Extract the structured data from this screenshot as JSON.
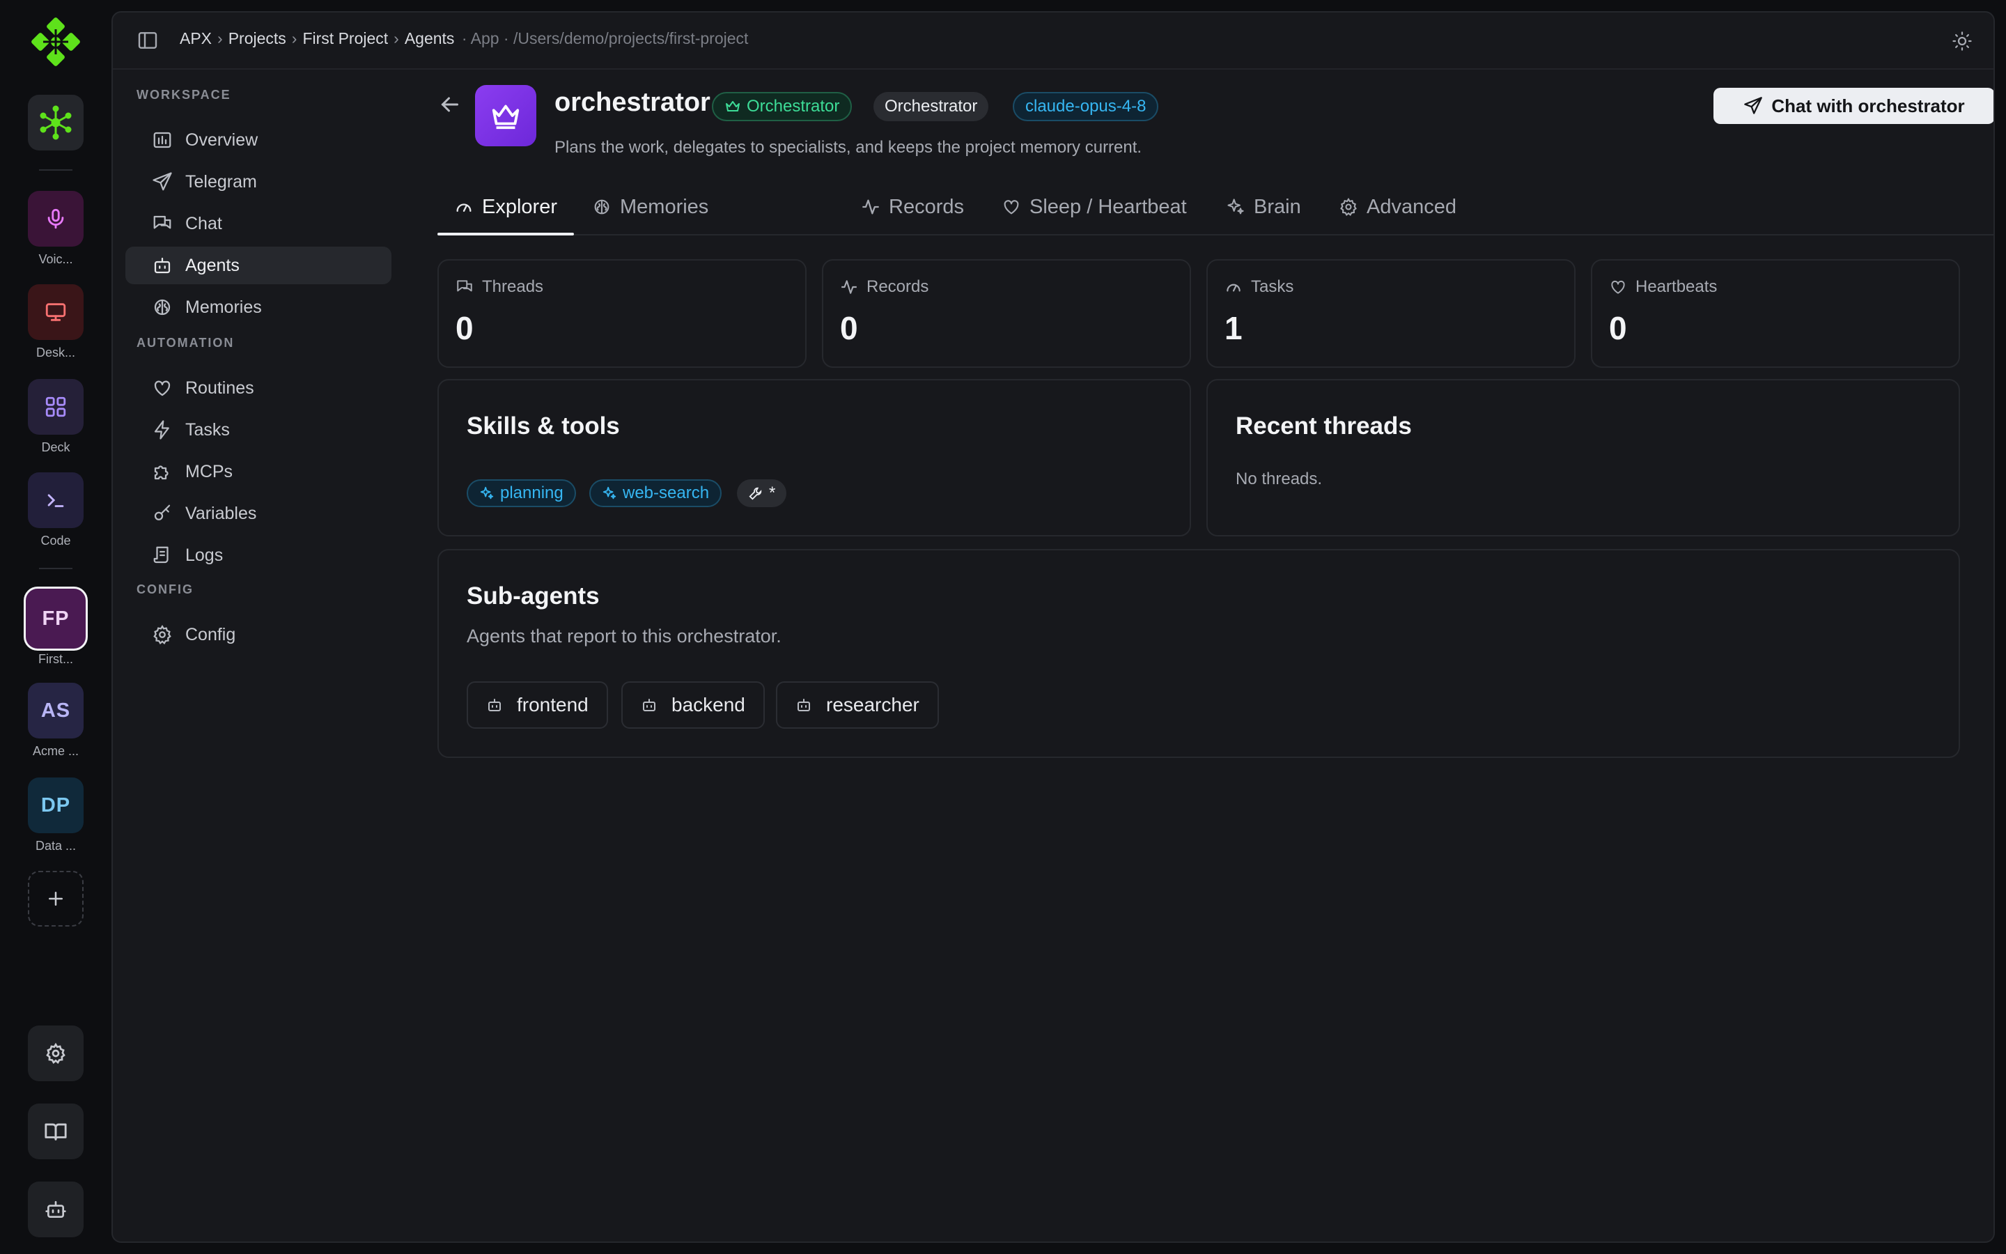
{
  "rail": {
    "items": [
      {
        "label": "Voic...",
        "icon": "mic-icon",
        "color": "#e879f9"
      },
      {
        "label": "Desk...",
        "icon": "monitor-icon",
        "color": "#f87171"
      },
      {
        "label": "Deck",
        "icon": "grid-icon",
        "color": "#a78bfa"
      },
      {
        "label": "Code",
        "icon": "terminal-icon",
        "color": "#c4b5fd"
      }
    ],
    "projects": [
      {
        "initials": "FP",
        "label": "First...",
        "active": true
      },
      {
        "initials": "AS",
        "label": "Acme ..."
      },
      {
        "initials": "DP",
        "label": "Data ..."
      }
    ]
  },
  "breadcrumb": {
    "items": [
      "APX",
      "Projects",
      "First Project",
      "Agents"
    ],
    "tail": "App · /Users/demo/projects/first-project"
  },
  "nav": {
    "workspace_label": "WORKSPACE",
    "workspace": [
      {
        "label": "Overview",
        "icon": "chart-icon"
      },
      {
        "label": "Telegram",
        "icon": "send-icon"
      },
      {
        "label": "Chat",
        "icon": "chat-icon"
      },
      {
        "label": "Agents",
        "icon": "bot-icon",
        "active": true
      },
      {
        "label": "Memories",
        "icon": "brain-icon"
      }
    ],
    "automation_label": "AUTOMATION",
    "automation": [
      {
        "label": "Routines",
        "icon": "heart-icon"
      },
      {
        "label": "Tasks",
        "icon": "bolt-icon"
      },
      {
        "label": "MCPs",
        "icon": "puzzle-icon"
      },
      {
        "label": "Variables",
        "icon": "key-icon"
      },
      {
        "label": "Logs",
        "icon": "scroll-icon"
      }
    ],
    "config_label": "CONFIG",
    "config": [
      {
        "label": "Config",
        "icon": "gear-icon"
      }
    ]
  },
  "agent": {
    "name": "orchestrator",
    "role_badge": "Orchestrator",
    "type_badge": "Orchestrator",
    "model_badge": "claude-opus-4-8",
    "description": "Plans the work, delegates to specialists, and keeps the project memory current.",
    "chat_button": "Chat with orchestrator"
  },
  "tabs": [
    "Explorer",
    "Memories",
    "Records",
    "Sleep / Heartbeat",
    "Brain",
    "Advanced"
  ],
  "stats": [
    {
      "label": "Threads",
      "value": "0"
    },
    {
      "label": "Records",
      "value": "0"
    },
    {
      "label": "Tasks",
      "value": "1"
    },
    {
      "label": "Heartbeats",
      "value": "0"
    }
  ],
  "skills": {
    "title": "Skills & tools",
    "chips": [
      "planning",
      "web-search"
    ],
    "tools_chip": "*"
  },
  "recent_threads": {
    "title": "Recent threads",
    "empty": "No threads."
  },
  "subagents": {
    "title": "Sub-agents",
    "subtitle": "Agents that report to this orchestrator.",
    "items": [
      "frontend",
      "backend",
      "researcher"
    ]
  },
  "colors": {
    "accent_green": "#3ddc97",
    "accent_blue": "#36b6f2",
    "agent_purple": "#7c3aed",
    "logo_green": "#5ee21b"
  }
}
